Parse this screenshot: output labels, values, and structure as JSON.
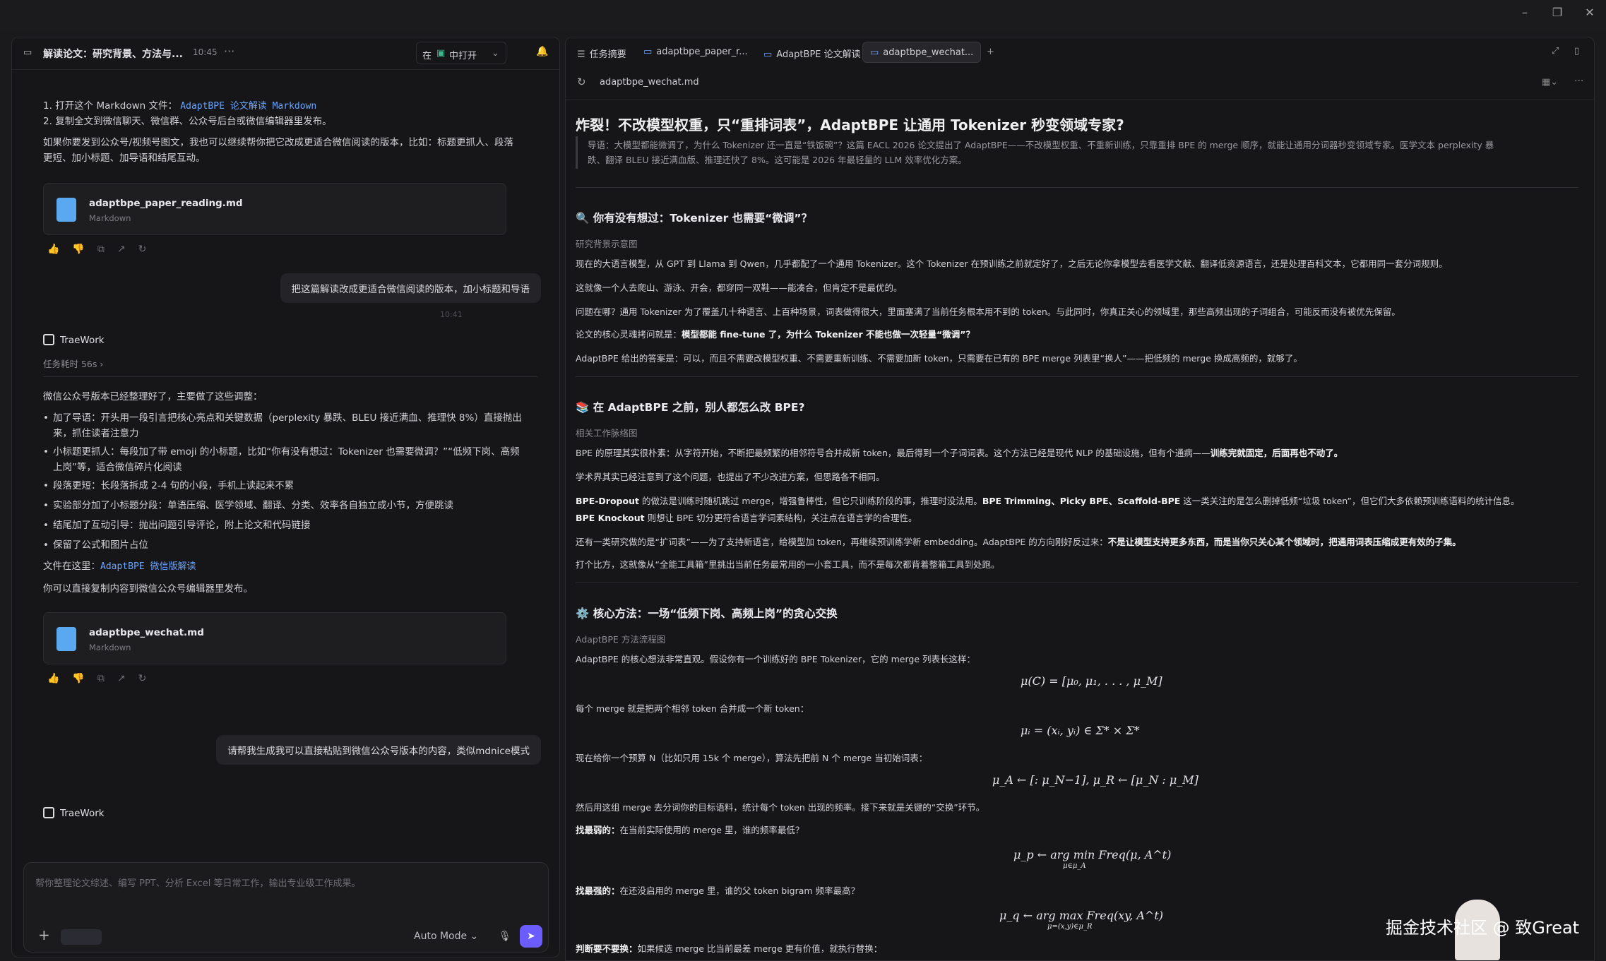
{
  "left": {
    "header": {
      "title": "解读论文：研究背景、方法与...",
      "time": "10:45",
      "open_prefix": "在",
      "open_label": "中打开"
    },
    "pre_items": [
      {
        "num": "1.",
        "text": "打开这个 Markdown 文件：",
        "link": "AdaptBPE 论文解读 Markdown"
      },
      {
        "num": "2.",
        "text": "复制全文到微信聊天、微信群、公众号后台或微信编辑器里发布。"
      }
    ],
    "pre_para_1": "如果你要发到公众号/视频号图文，我也可以继续帮你把它改成更适合微信阅读的版本，比如：标题更抓人、段落",
    "pre_para_2": "更短、加小标题、加导语和结尾互动。",
    "file1": {
      "name": "adaptbpe_paper_reading.md",
      "type": "Markdown"
    },
    "user_msg_1": "把这篇解读改成更适合微信阅读的版本，加小标题和导语",
    "user_msg_1_time": "10:41",
    "agent_name": "TraeWork",
    "task_time": "任务耗时 56s ›",
    "intro": "微信公众号版本已经整理好了，主要做了这些调整：",
    "bullets": [
      "加了导语：开头用一段引言把核心亮点和关键数据（perplexity 暴跌、BLEU 接近满血、推理快 8%）直接抛出",
      "来，抓住读者注意力",
      "小标题更抓人：每段加了带 emoji 的小标题，比如“你有没有想过：Tokenizer 也需要微调？”“低频下岗、高频",
      "上岗”等，适合微信碎片化阅读",
      "段落更短：长段落拆成 2-4 句的小段，手机上读起来不累",
      "实验部分加了小标题分段：单语压缩、医学领域、翻译、分类、效率各自独立成小节，方便跳读",
      "结尾加了互动引导：抛出问题引导评论，附上论文和代码链接",
      "保留了公式和图片占位"
    ],
    "file_here_label": "文件在这里：",
    "file_here_link": "AdaptBPE 微信版解读",
    "copy_note": "你可以直接复制内容到微信公众号编辑器里发布。",
    "file2": {
      "name": "adaptbpe_wechat.md",
      "type": "Markdown"
    },
    "user_msg_2": "请帮我生成我可以直接粘贴到微信公众号版本的内容，类似mdnice模式",
    "agent_name_2": "TraeWork",
    "composer": {
      "placeholder": "帮你整理论文综述、编写 PPT、分析 Excel 等日常工作，输出专业级工作成果。",
      "mode": "Auto Mode ⌄"
    }
  },
  "right": {
    "tabs": [
      {
        "icon": "☰",
        "label": "任务摘要"
      },
      {
        "icon": "▭",
        "label": "adaptbpe_paper_r..."
      },
      {
        "icon": "▭",
        "label": "AdaptBPE 论文解读"
      },
      {
        "icon": "▭",
        "label": "adaptbpe_wechat..."
      }
    ],
    "path": "adaptbpe_wechat.md",
    "doc": {
      "title": "炸裂！不改模型权重，只“重排词表”，AdaptBPE 让通用 Tokenizer 秒变领域专家?",
      "lead_1": "导语：大模型都能微调了，为什么 Tokenizer 还一直是“铁饭碗”？这篇 EACL 2026 论文提出了 AdaptBPE——不改模型权重、不重新训练，只靠重排 BPE 的 merge 顺序，就能让通用分词器秒变领域专家。医学文本 perplexity 暴",
      "lead_2": "跌、翻译 BLEU 接近满血版、推理还快了 8%。这可能是 2026 年最轻量的 LLM 效率优化方案。",
      "s1_title": "🔍 你有没有想过：Tokenizer 也需要“微调”？",
      "s1_cap": "研究背景示意图",
      "s1_p1": "现在的大语言模型，从 GPT 到 Llama 到 Qwen，几乎都配了一个通用 Tokenizer。这个 Tokenizer 在预训练之前就定好了，之后无论你拿模型去看医学文献、翻译低资源语言，还是处理百科文本，它都用同一套分词规则。",
      "s1_p2": "这就像一个人去爬山、游泳、开会，都穿同一双鞋——能凑合，但肯定不是最优的。",
      "s1_p3": "问题在哪？通用 Tokenizer 为了覆盖几十种语言、上百种场景，词表做得很大，里面塞满了当前任务根本用不到的 token。与此同时，你真正关心的领域里，那些高频出现的子词组合，可能反而没有被优先保留。",
      "s1_p4_a": "论文的核心灵魂拷问就是：",
      "s1_p4_b": "模型都能 fine-tune 了，为什么 Tokenizer 不能也做一次轻量“微调”？",
      "s1_p5": "AdaptBPE 给出的答案是：可以，而且不需要改模型权重、不需要重新训练、不需要加新 token，只需要在已有的 BPE merge 列表里“换人”——把低频的 merge 换成高频的，就够了。",
      "s2_title": "📚 在 AdaptBPE 之前，别人都怎么改 BPE?",
      "s2_cap": "相关工作脉络图",
      "s2_p1_a": "BPE 的原理其实很朴素：从字符开始，不断把最频繁的相邻符号合并成新 token，最后得到一个子词词表。这个方法已经是现代 NLP 的基础设施，但有个通病——",
      "s2_p1_b": "训练完就固定，后面再也不动了。",
      "s2_p2": "学术界其实已经注意到了这个问题，也提出了不少改进方案，但思路各不相同。",
      "s2_p3_a": "BPE-Dropout",
      "s2_p3_b": " 的做法是训练时随机跳过 merge，增强鲁棒性，但它只训练阶段的事，推理时没法用。",
      "s2_p3_c": "BPE Trimming、Picky BPE、Scaffold-BPE",
      "s2_p3_d": " 这一类关注的是怎么删掉低频“垃圾 token”，但它们大多依赖预训练语料的统计信息。",
      "s2_p4_a": "BPE Knockout",
      "s2_p4_b": " 则想让 BPE 切分更符合语言学词素结构，关注点在语言学的合理性。",
      "s2_p5_a": "还有一类研究做的是“扩词表”——为了支持新语言，给模型加 token，再继续预训练学新 embedding。AdaptBPE 的方向刚好反过来：",
      "s2_p5_b": "不是让模型支持更多东西，而是当你只关心某个领域时，把通用词表压缩成更有效的子集。",
      "s2_p6": "打个比方，这就像从“全能工具箱”里挑出当前任务最常用的一小套工具，而不是每次都背着整箱工具到处跑。",
      "s3_title": "⚙️ 核心方法：一场“低频下岗、高频上岗”的贪心交换",
      "s3_cap": "AdaptBPE 方法流程图",
      "s3_p1": "AdaptBPE 的核心想法非常直观。假设你有一个训练好的 BPE Tokenizer，它的 merge 列表长这样：",
      "eq1": "μ(C) = [μ₀, μ₁, . . . , μ_M]",
      "s3_p2": "每个 merge 就是把两个相邻 token 合并成一个新 token：",
      "eq2": "μᵢ = (xᵢ, yᵢ) ∈ Σ* × Σ*",
      "s3_p3": "现在给你一个预算 N（比如只用 15k 个 merge），算法先把前 N 个 merge 当初始词表：",
      "eq3": "μ_A ← [: μ_N−1],    μ_R ← [μ_N : μ_M]",
      "s3_p4": "然后用这组 merge 去分词你的目标语料，统计每个 token 出现的频率。接下来就是关键的“交换”环节。",
      "s3_p5_a": "找最弱的：",
      "s3_p5_b": "在当前实际使用的 merge 里，谁的频率最低？",
      "eq4": "μ_p ← arg min Freq(μ, A^t)",
      "eq4_sub": "μ∈μ_A",
      "s3_p6_a": "找最强的：",
      "s3_p6_b": "在还没启用的 merge 里，谁的父 token bigram 频率最高？",
      "eq5": "μ_q ← arg    max    Freq(xy, A^t)",
      "eq5_sub": "μ=(x,y)∈μ_R",
      "s3_p7_a": "判断要不要换：",
      "s3_p7_b": "如果候选 merge 比当前最差 merge 更有价值，就执行替换："
    }
  },
  "watermark": "掘金技术社区 @ 致Great",
  "colors": {
    "accent": "#6aa4ff",
    "send": "#6b5cff",
    "background": "#1a1a1c",
    "panel": "#161618"
  }
}
